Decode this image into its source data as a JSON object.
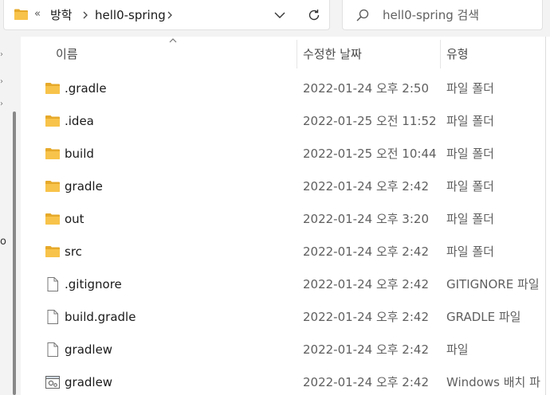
{
  "address": {
    "overflow_label": "«",
    "crumbs": [
      "방학",
      "hell0-spring"
    ],
    "history_icon": "chevron-down-icon",
    "refresh_icon": "refresh-icon"
  },
  "search": {
    "placeholder": "hell0-spring 검색"
  },
  "nav": {
    "fragment": "o"
  },
  "columns": {
    "name": "이름",
    "date": "수정한 날짜",
    "type": "유형"
  },
  "files": [
    {
      "name": ".gradle",
      "date": "2022-01-24 오후 2:50",
      "type": "파일 폴더",
      "icon": "folder-icon"
    },
    {
      "name": ".idea",
      "date": "2022-01-25 오전 11:52",
      "type": "파일 폴더",
      "icon": "folder-icon"
    },
    {
      "name": "build",
      "date": "2022-01-25 오전 10:44",
      "type": "파일 폴더",
      "icon": "folder-icon"
    },
    {
      "name": "gradle",
      "date": "2022-01-24 오후 2:42",
      "type": "파일 폴더",
      "icon": "folder-icon"
    },
    {
      "name": "out",
      "date": "2022-01-24 오후 3:20",
      "type": "파일 폴더",
      "icon": "folder-icon"
    },
    {
      "name": "src",
      "date": "2022-01-24 오후 2:42",
      "type": "파일 폴더",
      "icon": "folder-icon"
    },
    {
      "name": ".gitignore",
      "date": "2022-01-24 오후 2:42",
      "type": "GITIGNORE 파일",
      "icon": "file-icon"
    },
    {
      "name": "build.gradle",
      "date": "2022-01-24 오후 2:42",
      "type": "GRADLE 파일",
      "icon": "file-icon"
    },
    {
      "name": "gradlew",
      "date": "2022-01-24 오후 2:42",
      "type": "파일",
      "icon": "file-icon"
    },
    {
      "name": "gradlew",
      "date": "2022-01-24 오후 2:42",
      "type": "Windows 배치 파",
      "icon": "batch-file-icon"
    }
  ],
  "colors": {
    "folder": "#f8c34a",
    "folder_dark": "#e6a92a",
    "chrome_bg": "#f3f3f3"
  }
}
